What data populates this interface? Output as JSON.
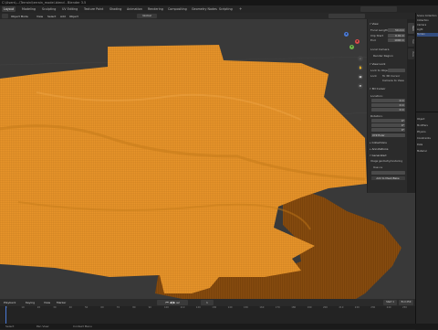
{
  "window": {
    "title": "C:\\Users\\...\\Terrain\\terrain_model.blend - Blender 3.5"
  },
  "workspaces": [
    "Layout",
    "Modeling",
    "Sculpting",
    "UV Editing",
    "Texture Paint",
    "Shading",
    "Animation",
    "Rendering",
    "Compositing",
    "Geometry Nodes",
    "Scripting"
  ],
  "active_workspace": "Layout",
  "header": {
    "view_label": "Object Mode",
    "view": "View",
    "select": "Select",
    "add": "Add",
    "object": "Object",
    "global": "Global"
  },
  "npanel": {
    "tabs": [
      "Item",
      "Tool",
      "View"
    ],
    "view_section": "View",
    "focal_label": "Focal Length",
    "focal_value": "50 mm",
    "clip_start_label": "Clip Start",
    "clip_start_value": "0.01 m",
    "clip_end_label": "End",
    "clip_end_value": "1000 m",
    "local_camera_label": "Local Camera",
    "render_region_label": "Render Region",
    "view_lock_section": "View Lock",
    "lock_to_object_label": "Lock to Object",
    "lock_label": "Lock",
    "to_3d_cursor": "To 3D Cursor",
    "camera_to_view": "Camera to View",
    "cursor_section": "3D Cursor",
    "location_label": "Location:",
    "loc_x": "0 m",
    "loc_y": "0 m",
    "loc_z": "0 m",
    "rotation_label": "Rotation:",
    "rot_x": "0°",
    "rot_y": "0°",
    "rot_z": "0°",
    "rotation_mode": "XYZ Euler",
    "collections_section": "Collections",
    "annotations_section": "Annotations",
    "generated_section": "Generated",
    "option_a": "Image geometry/rendering",
    "use_label": "Use uv",
    "apply_button": "Add to Mesh/Bake"
  },
  "outliner": {
    "rows": [
      "Scene Collection",
      "Collection",
      "Camera",
      "Light",
      "Terrain"
    ],
    "selected": "Terrain"
  },
  "properties": {
    "rows": [
      "Object",
      "Modifiers",
      "Physics",
      "Constraints",
      "Data",
      "Material"
    ]
  },
  "timeline": {
    "playback": "Playback",
    "keying": "Keying",
    "view": "View",
    "marker": "Marker",
    "current_frame": "1",
    "start": "Start 1",
    "end": "End 250",
    "ticks": [
      "0",
      "10",
      "20",
      "30",
      "40",
      "50",
      "60",
      "70",
      "80",
      "90",
      "100",
      "110",
      "120",
      "130",
      "140",
      "150",
      "160",
      "170",
      "180",
      "190",
      "200",
      "210",
      "220",
      "230",
      "240",
      "250"
    ]
  },
  "status": {
    "left": "Select",
    "mid": "Pan View",
    "right": "Context Menu"
  },
  "colors": {
    "terrain": "#e8952a",
    "terrain_shadow": "#8a4f0e",
    "viewport_bg": "#393939",
    "selection": "#334d80"
  }
}
